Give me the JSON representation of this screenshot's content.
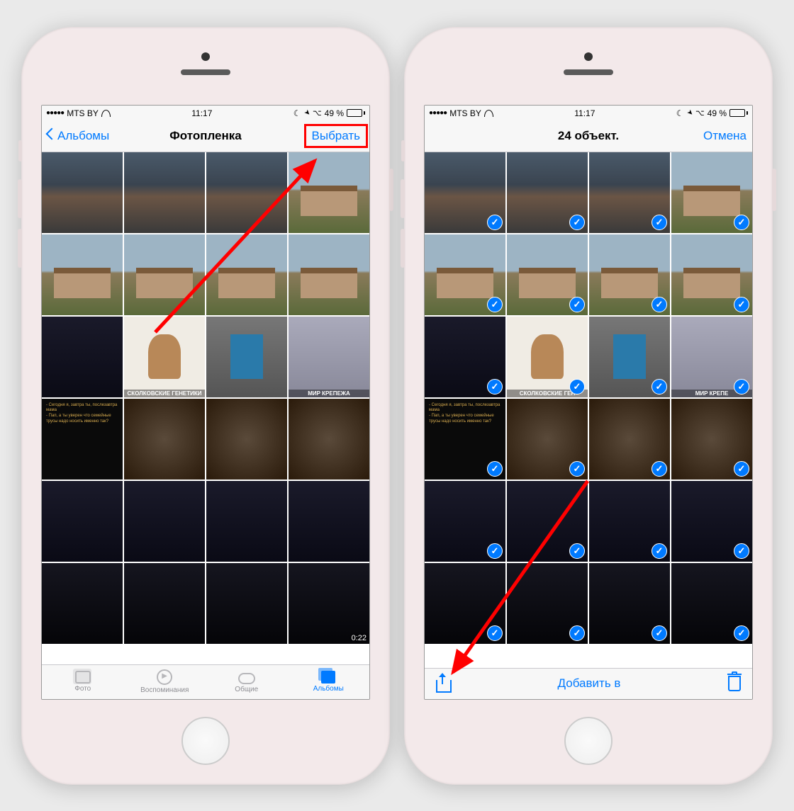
{
  "status": {
    "carrier": "MTS BY",
    "time": "11:17",
    "battery_pct": "49 %",
    "signal_dots": "●●●●●"
  },
  "phone1": {
    "nav": {
      "back": "Альбомы",
      "title": "Фотопленка",
      "select": "Выбрать"
    },
    "tabs": {
      "photos": "Фото",
      "memories": "Воспоминания",
      "shared": "Общие",
      "albums": "Альбомы"
    },
    "video_duration": "0:22",
    "thumb_labels": {
      "genetics": "СКОЛКОВСКИЕ ГЕНЕТИКИ",
      "fasteners": "МИР КРЕПЕЖА"
    }
  },
  "phone2": {
    "nav": {
      "title": "24 объект.",
      "cancel": "Отмена"
    },
    "toolbar": {
      "add_to": "Добавить в"
    },
    "thumb_labels": {
      "genetics": "СКОЛКОВСКИЕ ГЕН",
      "fasteners": "МИР КРЕПЕ"
    }
  },
  "colors": {
    "accent": "#007aff",
    "highlight": "#ff0000",
    "battery_fill": "#ffcc00"
  }
}
